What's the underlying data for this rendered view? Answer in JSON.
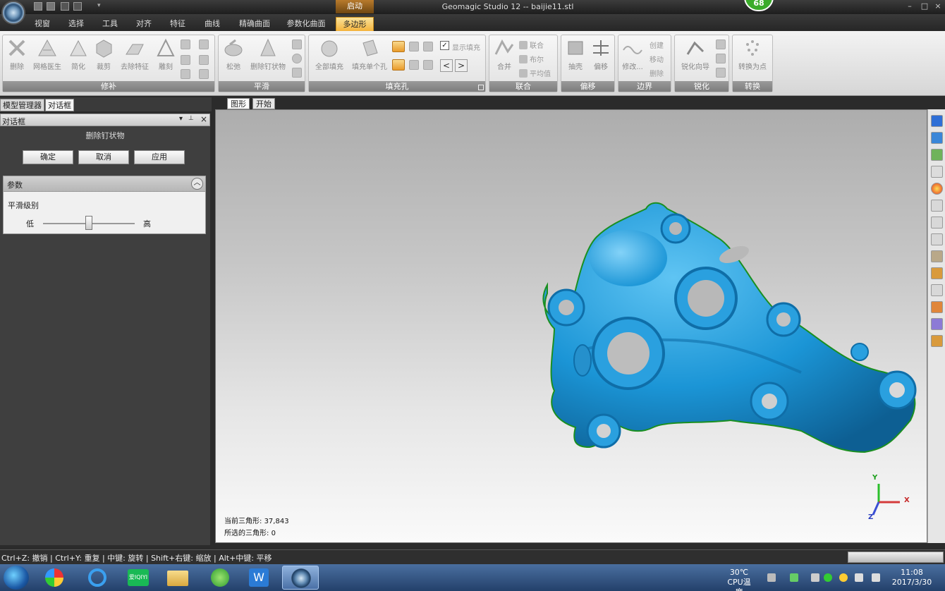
{
  "titlebar": {
    "window_title": "Geomagic Studio 12 -- baijie11.stl",
    "context_tab": "启动",
    "badge_count": "68",
    "minimize": "–",
    "maximize": "□",
    "close": "×"
  },
  "ribbon_tabs": [
    {
      "label": "视窗"
    },
    {
      "label": "选择"
    },
    {
      "label": "工具"
    },
    {
      "label": "对齐"
    },
    {
      "label": "特征"
    },
    {
      "label": "曲线"
    },
    {
      "label": "精确曲面"
    },
    {
      "label": "参数化曲面"
    },
    {
      "label": "多边形"
    }
  ],
  "active_ribbon_tab": "多边形",
  "help_label": "?",
  "ribbon": {
    "repair": {
      "label": "修补",
      "buttons": [
        "删除",
        "网格医生",
        "简化",
        "裁剪",
        "去除特征",
        "雕刻"
      ]
    },
    "smooth": {
      "label": "平滑",
      "buttons": [
        "松弛",
        "删除钉状物"
      ]
    },
    "fill": {
      "label": "填充孔",
      "buttons": [
        "全部填充",
        "填充单个孔"
      ],
      "checkbox_label": "显示填充",
      "checkbox_checked": true,
      "prev": "<",
      "next": ">"
    },
    "combine": {
      "label": "联合",
      "big": "合并",
      "small": [
        "联合",
        "布尔",
        "平均值"
      ]
    },
    "offset": {
      "label": "偏移",
      "buttons": [
        "抽壳",
        "偏移"
      ]
    },
    "boundary": {
      "label": "边界",
      "big": "修改...",
      "small": [
        "创建",
        "移动",
        "删除"
      ]
    },
    "sharpen": {
      "label": "锐化",
      "big": "锐化向导"
    },
    "convert": {
      "label": "转换",
      "big": "转换为点"
    }
  },
  "left_panel": {
    "tabs": [
      "模型管理器",
      "对话框"
    ],
    "active_tab": "对话框",
    "header": "对话框",
    "header_controls": [
      "▾",
      "📌",
      "×"
    ],
    "operation_title": "删除钉状物",
    "buttons": {
      "ok": "确定",
      "cancel": "取消",
      "apply": "应用"
    },
    "params": {
      "title": "参数",
      "smooth_level_label": "平滑级别",
      "low": "低",
      "high": "高",
      "slider_value": 0.5
    }
  },
  "viewport": {
    "tabs": [
      "图形",
      "开始"
    ],
    "active_tab": "图形",
    "stats": {
      "current_triangles_label": "当前三角形:",
      "current_triangles": "37,843",
      "selected_triangles_label": "所选的三角形:",
      "selected_triangles": "0"
    },
    "axes": {
      "x": "X",
      "y": "Y",
      "z": "Z"
    },
    "mesh_color": "#2196d6"
  },
  "statusbar": {
    "hint": "Ctrl+Z: 撤销 | Ctrl+Y: 重复 | 中键: 旋转 | Shift+右键: 缩放 | Alt+中键: 平移"
  },
  "taskbar": {
    "apps": [
      "start-orb",
      "color-app",
      "ie-browser",
      "iqiyi",
      "file-explorer",
      "360-browser",
      "wps-writer",
      "geomagic-studio"
    ],
    "iqiyi_text": "爱IQIYI",
    "wps_text": "W",
    "temperature": "30℃",
    "temperature_label": "CPU温度",
    "time": "11:08",
    "date": "2017/3/30"
  }
}
